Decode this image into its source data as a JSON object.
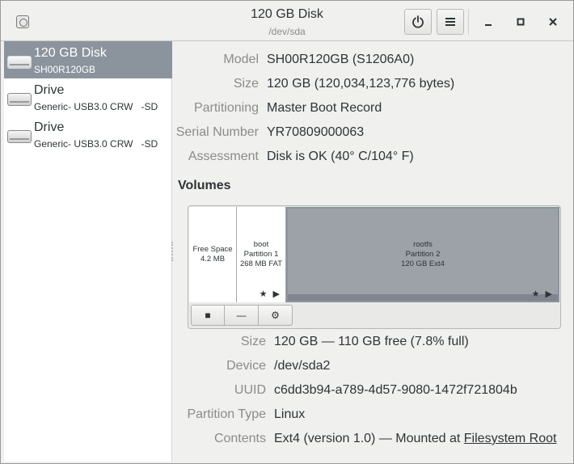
{
  "window": {
    "title": "120 GB Disk",
    "subtitle": "/dev/sda"
  },
  "header": {
    "app_icon": "disks-app-icon",
    "power_icon": "power-icon",
    "menu_icon": "hamburger-menu-icon",
    "minimize_glyph": "—",
    "maximize_glyph": "□",
    "close_glyph": "✕"
  },
  "sidebar": {
    "items": [
      {
        "name": "120 GB Disk",
        "sub": "SH00R120GB",
        "selected": true
      },
      {
        "name": "Drive",
        "sub": "Generic- USB3.0 CRW   -SD",
        "selected": false
      },
      {
        "name": "Drive",
        "sub": "Generic- USB3.0 CRW   -SD",
        "selected": false
      }
    ]
  },
  "disk_properties": [
    {
      "label": "Model",
      "value": "SH00R120GB (S1206A0)"
    },
    {
      "label": "Size",
      "value": "120 GB (120,034,123,776 bytes)"
    },
    {
      "label": "Partitioning",
      "value": "Master Boot Record"
    },
    {
      "label": "Serial Number",
      "value": "YR70809000063"
    },
    {
      "label": "Assessment",
      "value": "Disk is OK (40° C/104° F)"
    }
  ],
  "volumes": {
    "heading": "Volumes",
    "partitions": [
      {
        "line1": "Free Space",
        "line2": "4.2 MB"
      },
      {
        "line1": "boot",
        "line2": "Partition 1",
        "line3": "268 MB FAT",
        "icons": "★ ▶"
      },
      {
        "line1": "rootfs",
        "line2": "Partition 2",
        "line3": "120 GB Ext4",
        "icons": "★ ▶",
        "selected": true
      }
    ],
    "toolbar": {
      "stop_glyph": "■",
      "remove_glyph": "—",
      "settings_glyph": "⚙"
    }
  },
  "partition_properties": [
    {
      "label": "Size",
      "value": "120 GB — 110 GB free (7.8% full)"
    },
    {
      "label": "Device",
      "value": "/dev/sda2"
    },
    {
      "label": "UUID",
      "value": "c6dd3b94-a789-4d57-9080-1472f721804b"
    },
    {
      "label": "Partition Type",
      "value": "Linux"
    },
    {
      "label": "Contents",
      "value": "Ext4 (version 1.0) — Mounted at ",
      "link": "Filesystem Root"
    }
  ],
  "colors": {
    "selection": "#8b949c",
    "label": "#8a8d88",
    "text": "#2e3436"
  }
}
